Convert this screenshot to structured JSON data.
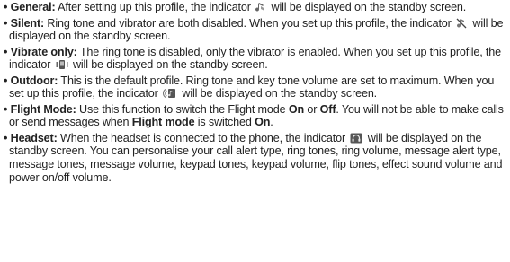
{
  "profiles": [
    {
      "term": "General:",
      "text_a": " After setting up this profile, the indicator ",
      "icon": "general-profile-icon",
      "text_b": " will be displayed on the standby screen."
    },
    {
      "term": "Silent:",
      "text_a": " Ring tone and vibrator are both disabled. When you set up this profile, the indicator ",
      "icon": "silent-profile-icon",
      "text_b": " will be displayed on the standby screen."
    },
    {
      "term": "Vibrate only:",
      "text_a": " The ring tone is disabled, only the vibrator is enabled. When you set up this profile, the indicator ",
      "icon": "vibrate-profile-icon",
      "text_b": " will be displayed on the standby screen."
    },
    {
      "term": "Outdoor:",
      "text_a": " This is the default profile. Ring tone and key tone volume are set to maximum. When you set up this profile, the indicator ",
      "icon": "outdoor-profile-icon",
      "text_b": " will be displayed on the standby screen."
    },
    {
      "term": "Flight Mode:",
      "text_a": " Use this function to switch the Flight mode ",
      "on": "On",
      "or": " or ",
      "off": "Off",
      "text_b": ". You will not be able to make calls or send messages when ",
      "flight_mode": "Flight mode",
      "text_c": " is switched ",
      "on_end": "On",
      "period": "."
    },
    {
      "term": "Headset:",
      "text_a": " When the headset is connected to the phone, the indicator ",
      "icon": "headset-profile-icon",
      "text_b": " will be displayed on the standby screen. You can personalise your call alert type, ring tones, ring volume, message alert type, message tones, message volume, keypad tones, keypad volume, flip tones, effect sound volume and power on/off volume."
    }
  ],
  "bullet": "•",
  "colors": {
    "text": "#222222",
    "icon_gray": "#6a6a6a"
  }
}
